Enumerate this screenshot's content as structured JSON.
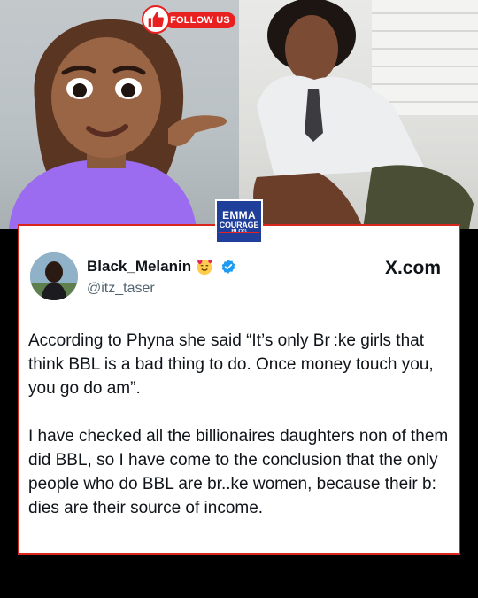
{
  "header": {
    "follow_label": "FOLLOW US",
    "brand": {
      "line1": "EMMA",
      "line2": "COURAGE",
      "line3": "BLOG"
    }
  },
  "tweet": {
    "display_name": "Black_Melanin",
    "handle": "@itz_taser",
    "source": "X.com",
    "paragraphs": [
      "According to Phyna she said “It’s only Br :ke girls that think BBL is a bad thing to do. Once money touch you, you go do am”.",
      "I have checked all the billionaires daughters non of them did BBL, so I have come to the conclusion that the only people who do BBL are br..ke women, because their b: dies are their source of income."
    ]
  },
  "colors": {
    "accent": "#d9271e",
    "verified": "#1d9bf0",
    "brand_blue": "#1f3f9b"
  },
  "icons": [
    "thumbs-up-icon",
    "smiling-face-with-hearts-emoji",
    "verified-badge-icon"
  ]
}
